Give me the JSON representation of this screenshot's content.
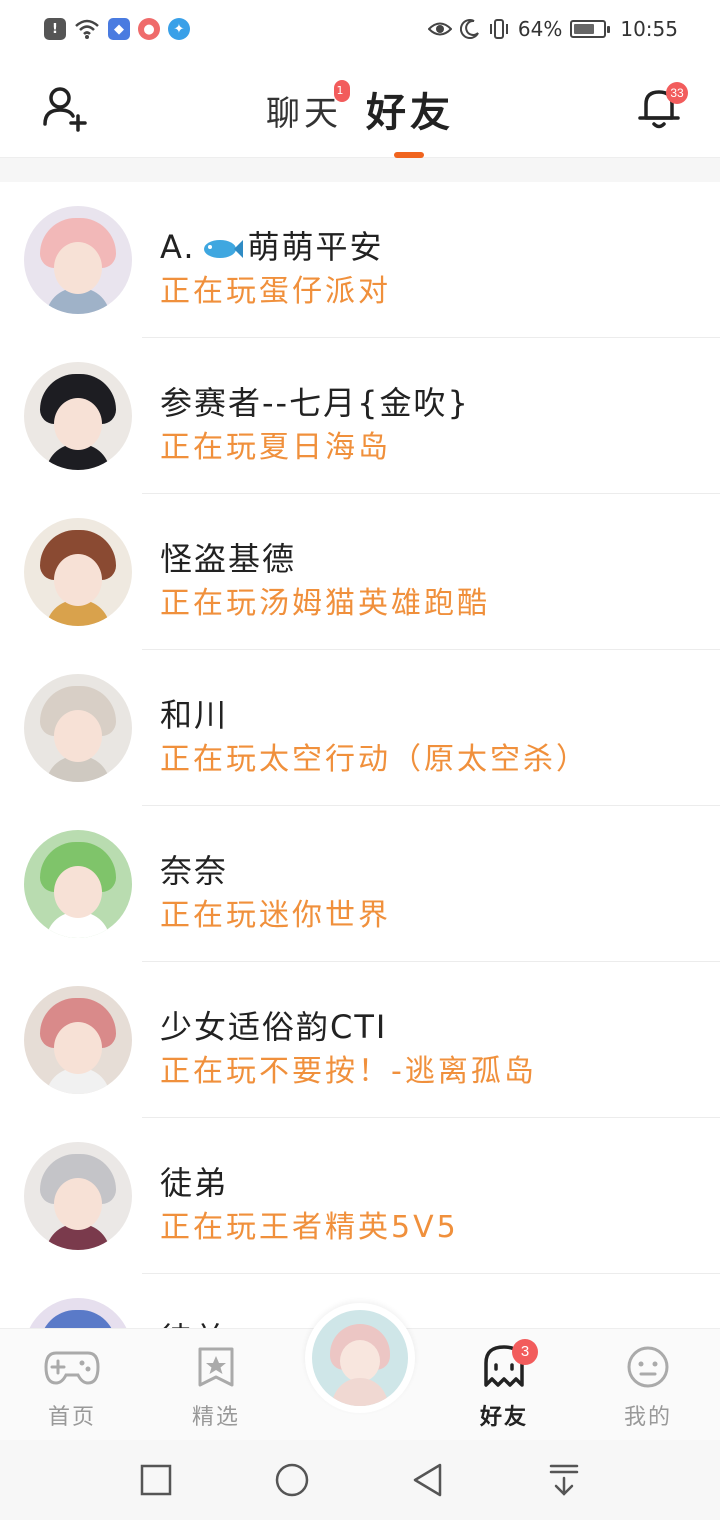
{
  "status_bar": {
    "battery": "64%",
    "time": "10:55"
  },
  "header": {
    "tabs": [
      {
        "label": "聊天",
        "badge": "1",
        "active": false
      },
      {
        "label": "好友",
        "active": true
      }
    ],
    "bell_badge": "33"
  },
  "friends": [
    {
      "name_prefix": "A.",
      "name": "萌萌平安",
      "status": "正在玩蛋仔派对",
      "avatar_hair": "#f2b8b8",
      "avatar_bg": "#e9e4ee",
      "avatar_body": "#9fb2c8"
    },
    {
      "name": "参赛者--七月{金吹}",
      "status": "正在玩夏日海岛",
      "avatar_hair": "#1d1d22",
      "avatar_bg": "#ece8e4",
      "avatar_body": "#1d1d22"
    },
    {
      "name": "怪盗基德",
      "status": "正在玩汤姆猫英雄跑酷",
      "avatar_hair": "#8a4a32",
      "avatar_bg": "#efe9e0",
      "avatar_body": "#d9a24c"
    },
    {
      "name": "和川",
      "status": "正在玩太空行动（原太空杀）",
      "avatar_hair": "#d8cfc6",
      "avatar_bg": "#e9e6e2",
      "avatar_body": "#cfc9c1"
    },
    {
      "name": "奈奈",
      "status": "正在玩迷你世界",
      "avatar_hair": "#7fc46a",
      "avatar_bg": "#b9dcb0",
      "avatar_body": "#ffffff"
    },
    {
      "name": "少女适俗韵CTI",
      "status": "正在玩不要按！-逃离孤岛",
      "avatar_hair": "#d98a8a",
      "avatar_bg": "#e6ddd6",
      "avatar_body": "#f1f1f1"
    },
    {
      "name": "徒弟",
      "status": "正在玩王者精英5V5",
      "avatar_hair": "#c4c4c8",
      "avatar_bg": "#ebe8e6",
      "avatar_body": "#7a3a4c"
    },
    {
      "name": "徒弟",
      "status": "",
      "avatar_hair": "#5a7ac8",
      "avatar_bg": "#e6dfee",
      "avatar_body": "#c85a5a"
    }
  ],
  "bottom_nav": [
    {
      "label": "首页"
    },
    {
      "label": "精选"
    },
    {
      "label": "好友",
      "badge": "3"
    },
    {
      "label": "我的"
    }
  ],
  "colors": {
    "accent": "#f0641e",
    "status_text": "#f0903c",
    "badge": "#f25c5c"
  }
}
